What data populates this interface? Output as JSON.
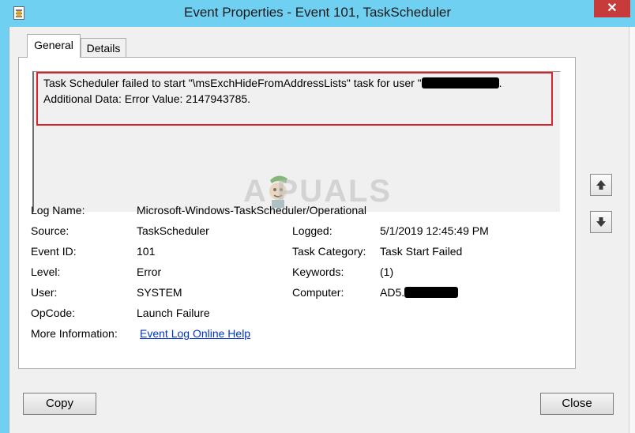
{
  "window": {
    "title": "Event Properties - Event 101, TaskScheduler",
    "close_glyph": "✕"
  },
  "tabs": [
    {
      "label": "General"
    },
    {
      "label": "Details"
    }
  ],
  "message": {
    "line1_prefix": "Task Scheduler failed to start \"\\msExchHideFromAddressLists\" task for user \"",
    "line1_suffix": ".",
    "line2": "Additional Data: Error Value: 2147943785."
  },
  "watermark": {
    "text": "A PUALS"
  },
  "fields": {
    "log_name": {
      "label": "Log Name:",
      "value": "Microsoft-Windows-TaskScheduler/Operational"
    },
    "source": {
      "label": "Source:",
      "value": "TaskScheduler"
    },
    "logged": {
      "label": "Logged:",
      "value": "5/1/2019 12:45:49 PM"
    },
    "event_id": {
      "label": "Event ID:",
      "value": "101"
    },
    "task_category": {
      "label": "Task Category:",
      "value": "Task Start Failed"
    },
    "level": {
      "label": "Level:",
      "value": "Error"
    },
    "keywords": {
      "label": "Keywords:",
      "value": "(1)"
    },
    "user": {
      "label": "User:",
      "value": "SYSTEM"
    },
    "computer": {
      "label": "Computer:",
      "value_prefix": "AD5."
    },
    "opcode": {
      "label": "OpCode:",
      "value": "Launch Failure"
    },
    "more_info": {
      "label": "More Information:",
      "link": "Event Log Online Help"
    }
  },
  "buttons": {
    "copy": "Copy",
    "close": "Close"
  },
  "colors": {
    "title_bar": "#6fd0f2",
    "highlight": "#d8232a",
    "link": "#0033cc",
    "close_button": "#c83b3b"
  },
  "icons": {
    "scroll_up": "arrow-up-icon",
    "scroll_down": "arrow-down-icon",
    "app": "event-viewer-icon"
  }
}
